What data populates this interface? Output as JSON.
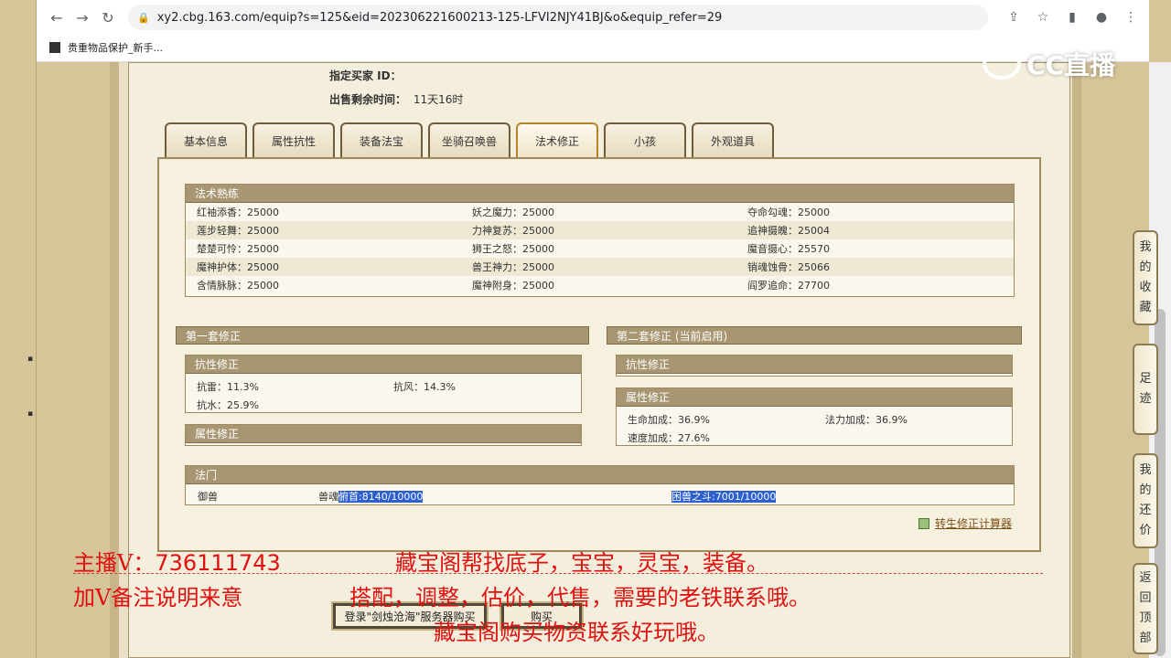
{
  "browser": {
    "url": "xy2.cbg.163.com/equip?s=125&eid=202306221600213-125-LFVI2NJY41BJ&o&equip_refer=29",
    "bookmark": "贵重物品保护_新手..."
  },
  "watermark": {
    "text": "CC直播"
  },
  "info": {
    "buyer_label": "指定买家 ID：",
    "remaining_label": "出售剩余时间：",
    "remaining_value": "11天16时"
  },
  "tabs": [
    "基本信息",
    "属性抗性",
    "装备法宝",
    "坐骑召唤兽",
    "法术修正",
    "小孩",
    "外观道具"
  ],
  "active_tab": 4,
  "spell_mastery": {
    "title": "法术熟练",
    "rows": [
      [
        "红袖添香：25000",
        "妖之魔力：25000",
        "夺命勾魂：25000"
      ],
      [
        "莲步轻舞：25000",
        "力神复苏：25000",
        "追神摄魄：25004"
      ],
      [
        "楚楚可怜：25000",
        "狮王之怒：25000",
        "魔音摄心：25570"
      ],
      [
        "魔神护体：25000",
        "兽王神力：25000",
        "销魂蚀骨：25066"
      ],
      [
        "含情脉脉：25000",
        "魔神附身：25000",
        "阎罗追命：27700"
      ]
    ]
  },
  "set1": {
    "title": "第一套修正",
    "resist": {
      "title": "抗性修正",
      "items": [
        "抗雷：11.3%",
        "抗风：14.3%",
        "抗水：25.9%"
      ]
    },
    "attr": {
      "title": "属性修正"
    }
  },
  "set2": {
    "title": "第二套修正 (当前启用)",
    "resist": {
      "title": "抗性修正"
    },
    "attr": {
      "title": "属性修正",
      "items": [
        "生命加成：36.9%",
        "法力加成：36.9%",
        "速度加成：27.6%"
      ]
    }
  },
  "school": {
    "title": "法门",
    "name": "御兽",
    "item1_prefix": "兽魂",
    "item1_highlight": "俯首:8140/10000",
    "item2_highlight": "困兽之斗:7001/10000"
  },
  "calc_link": "转生修正计算器",
  "side_buttons": {
    "favorites": [
      "我",
      "的",
      "收",
      "藏"
    ],
    "footprints": [
      "足",
      "迹"
    ],
    "bargain": [
      "我",
      "的",
      "还",
      "价"
    ],
    "top": [
      "返",
      "回",
      "顶",
      "部"
    ]
  },
  "bottom_buttons": {
    "login": "登录\"剑烛沧海\"服务器购买",
    "buy": "购买"
  },
  "overlay": {
    "line1_left": "主播V：",
    "line1_num": "736111743",
    "line1_right": "藏宝阁帮找底子，宝宝，灵宝，装备。",
    "line2_left": "加V备注说明来意",
    "line2_right": "搭配，调整，估价，代售，需要的老铁联系哦。",
    "line3": "藏宝阁购买物资联系好玩哦。",
    "color": "#e01010"
  }
}
